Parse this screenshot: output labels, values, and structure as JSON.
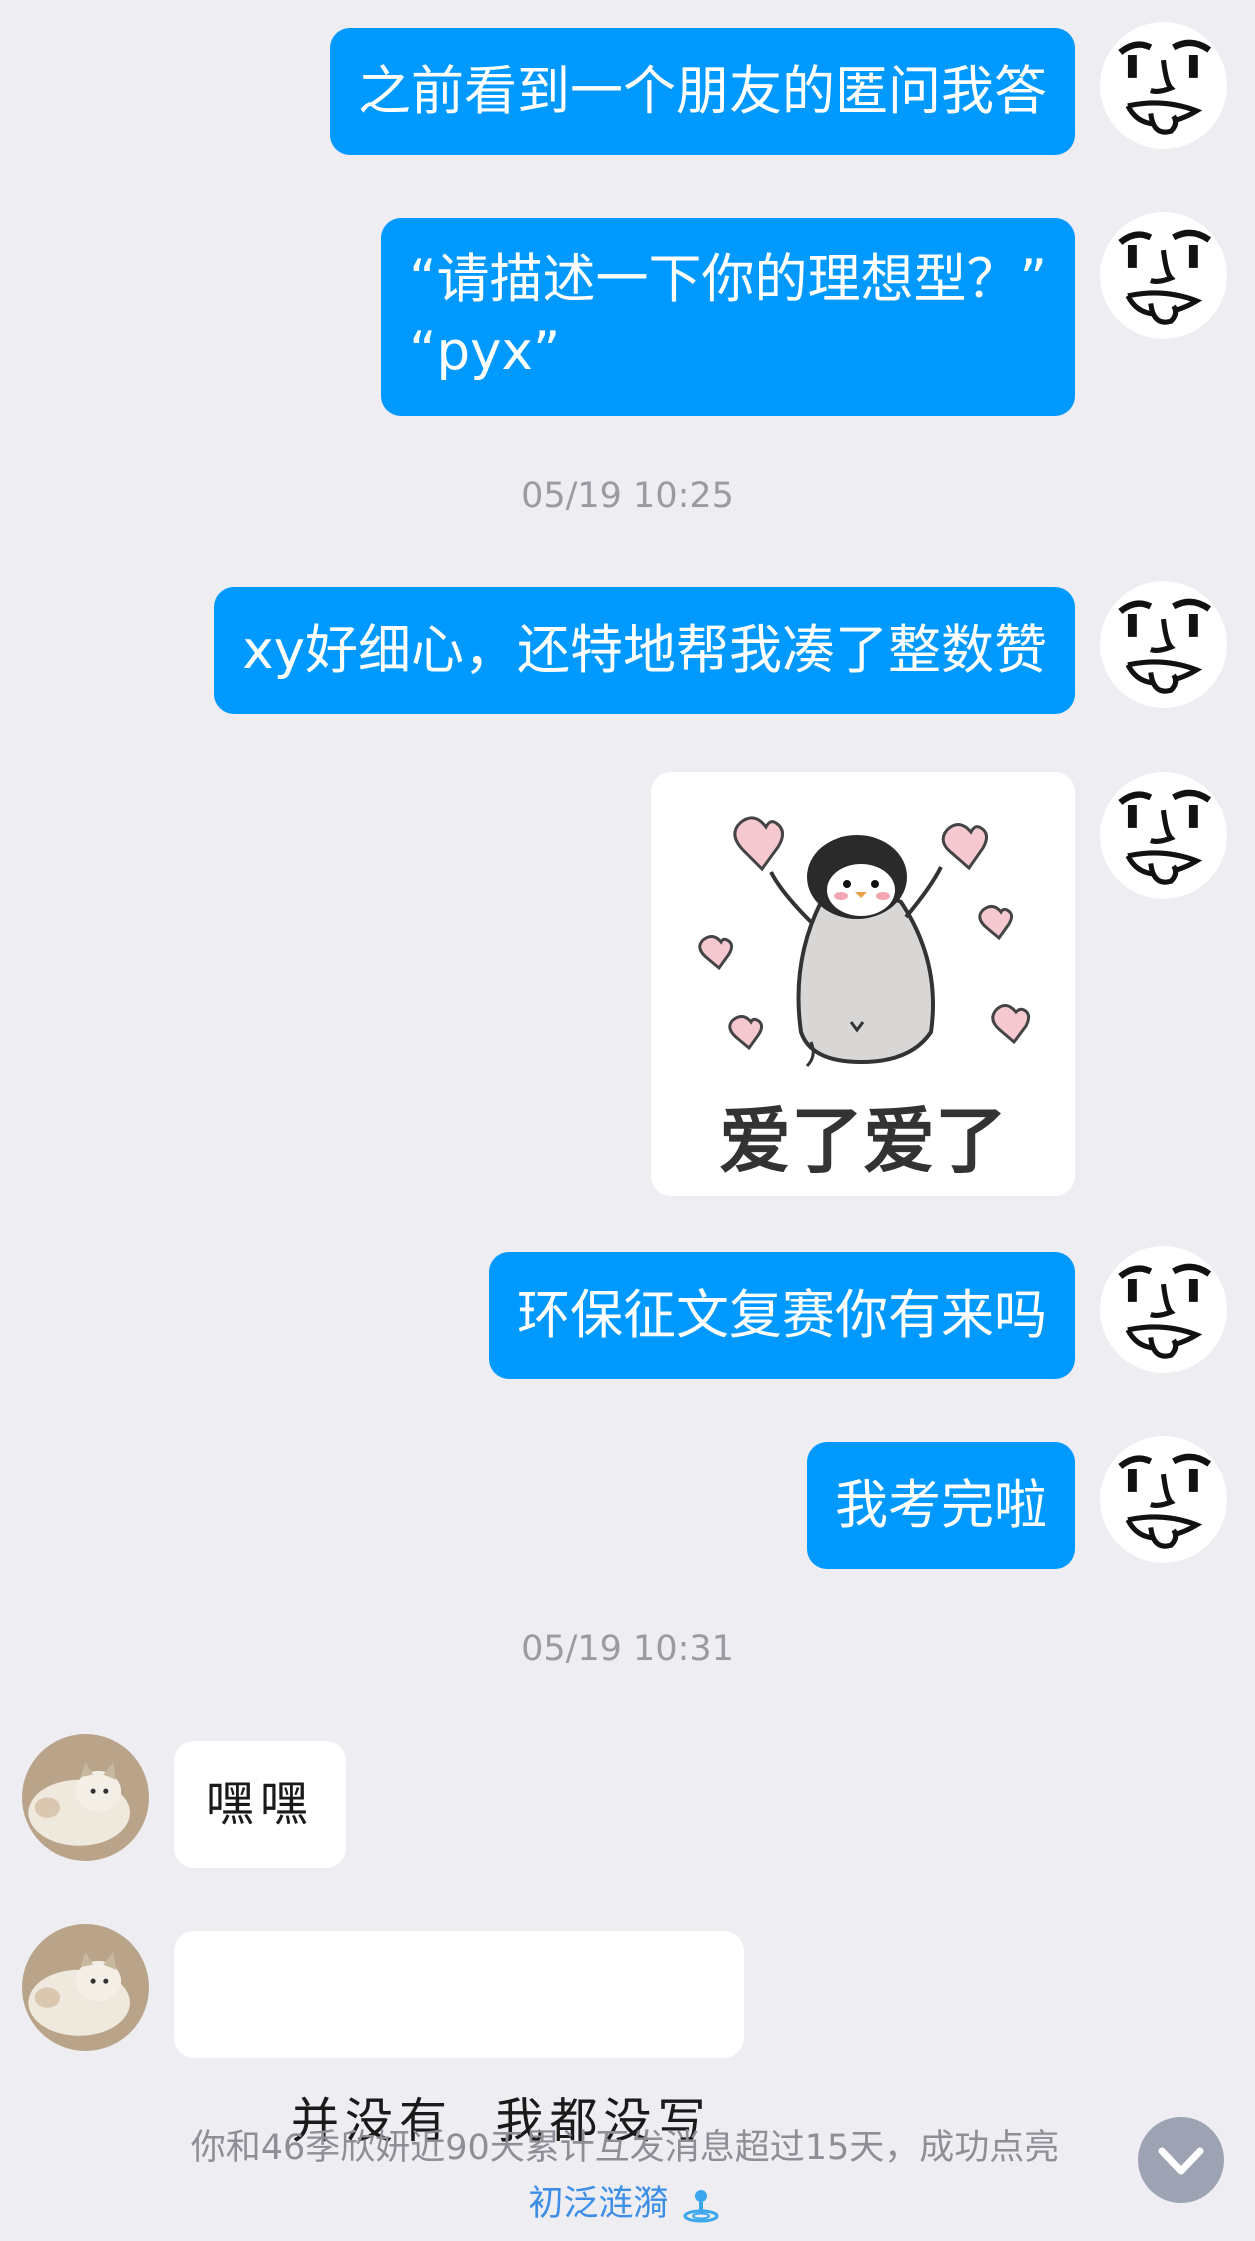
{
  "messages": {
    "m1": "之前看到一个朋友的匿问我答",
    "m2_line1": "“请描述一下你的理想型？”",
    "m2_line2": "“pyx”",
    "m3": "xy好细心，还特地帮我凑了整数赞",
    "sticker_caption": "爱了爱了",
    "m4": "环保征文复赛你有来吗",
    "m5": "我考完啦",
    "r1": "嘿嘿",
    "r2": "并没有  我都没写"
  },
  "timestamps": {
    "t1": "05/19 10:25",
    "t2": "05/19 10:31"
  },
  "notice": {
    "text": "你和46季欣妍近90天累计互发消息超过15天，成功点亮",
    "highlight": "初泛涟漪"
  },
  "colors": {
    "outgoing_bubble": "#0099ff",
    "incoming_bubble": "#ffffff",
    "background": "#ededf2",
    "timestamp": "#9a9aa2",
    "link": "#3d8ee6"
  },
  "icons": {
    "self_avatar": "smirk-face-icon",
    "other_avatar": "cat-photo-icon",
    "scroll": "chevron-down-icon",
    "badge": "ripple-icon"
  }
}
